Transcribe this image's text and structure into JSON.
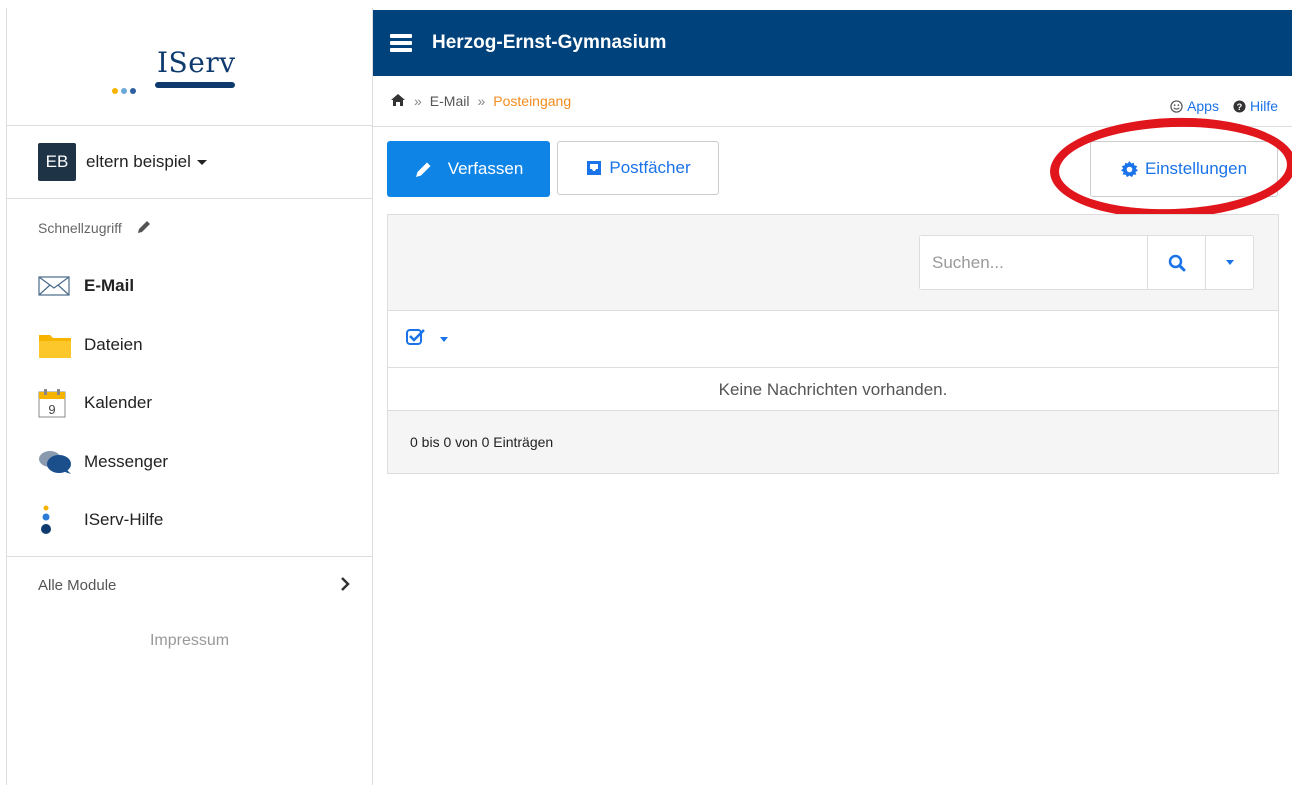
{
  "logo": {
    "text": "IServ"
  },
  "user": {
    "initials": "EB",
    "name": "eltern beispiel"
  },
  "sidebar": {
    "quick_access_label": "Schnellzugriff",
    "items": [
      {
        "label": "E-Mail",
        "icon": "envelope-icon",
        "active": true
      },
      {
        "label": "Dateien",
        "icon": "folder-icon",
        "active": false
      },
      {
        "label": "Kalender",
        "icon": "calendar-icon",
        "active": false
      },
      {
        "label": "Messenger",
        "icon": "chat-bubbles-icon",
        "active": false
      },
      {
        "label": "IServ-Hilfe",
        "icon": "iserv-help-icon",
        "active": false
      }
    ],
    "all_modules_label": "Alle Module",
    "impressum_label": "Impressum"
  },
  "topbar": {
    "school_name": "Herzog-Ernst-Gymnasium"
  },
  "breadcrumb": {
    "separator": "»",
    "items": [
      "E-Mail",
      "Posteingang"
    ],
    "apps_label": "Apps",
    "help_label": "Hilfe"
  },
  "toolbar": {
    "compose_label": "Verfassen",
    "mailboxes_label": "Postfächer",
    "settings_label": "Einstellungen"
  },
  "mail": {
    "search_placeholder": "Suchen...",
    "empty_message": "Keine Nachrichten vorhanden.",
    "pagination_info": "0 bis 0 von 0 Einträgen"
  },
  "colors": {
    "topbar": "#00427c",
    "primary": "#0d84e6",
    "link": "#1a73e8",
    "breadcrumb_current": "#f28c1e",
    "highlight_circle": "#e1151c"
  }
}
